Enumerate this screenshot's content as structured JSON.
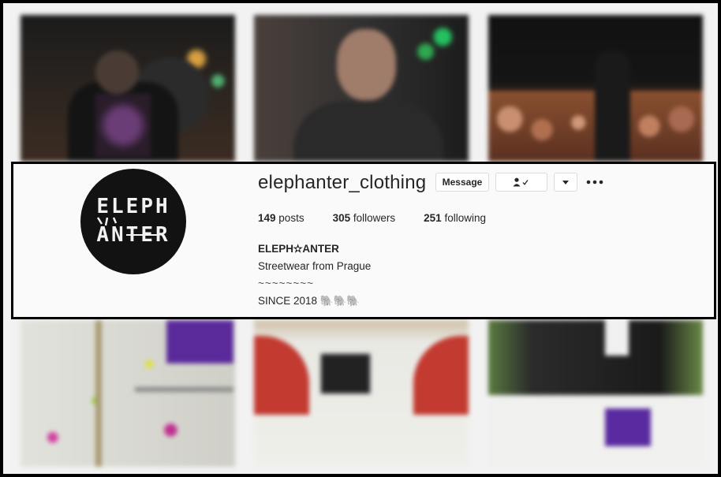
{
  "profile": {
    "username": "elephanter_clothing",
    "avatar_text_top": "ELEPH",
    "avatar_text_bottom": "ANTER"
  },
  "buttons": {
    "message_label": "Message",
    "follow_icon": "person-check-icon",
    "dropdown_icon": "chevron-down-icon",
    "more_icon": "more-options-icon"
  },
  "stats": {
    "posts_count": "149",
    "posts_label": "posts",
    "followers_count": "305",
    "followers_label": "followers",
    "following_count": "251",
    "following_label": "following"
  },
  "bio": {
    "name": "ELEPH✫ANTER",
    "line1": "Streetwear from Prague",
    "line2": "~~~~~~~~",
    "line3": "SINCE 2018 🐘🐘🐘",
    "line4": "~~~~~~~~"
  },
  "colors": {
    "text": "#262626",
    "border": "#dbdbdb",
    "background": "#fafafa"
  }
}
